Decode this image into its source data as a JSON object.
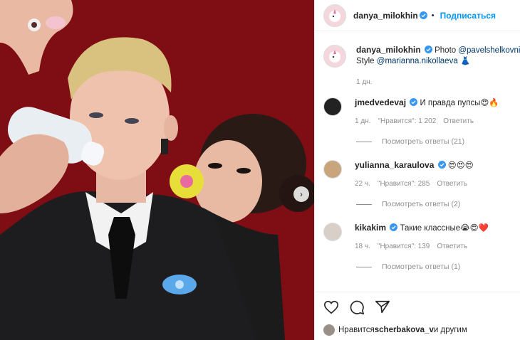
{
  "header": {
    "username": "danya_milokhin",
    "follow_label": "Подписаться",
    "dot": "•"
  },
  "caption": {
    "username": "danya_milokhin",
    "text_prefix": "Photo ",
    "mention_photo": "@pavelshelkovnikov",
    "text_style": "Style ",
    "mention_style": "@marianna.nikollaeva",
    "emoji": "👗",
    "time": "1 дн."
  },
  "comments": [
    {
      "username": "jmedvedevaj",
      "verified": true,
      "text": "И правда пупсы😍🔥",
      "time": "1 дн.",
      "likes": "\"Нравится\": 1 202",
      "reply_label": "Ответить",
      "replies_label": "Посмотреть ответы (21)"
    },
    {
      "username": "yulianna_karaulova",
      "verified": true,
      "text": "😍😍😍",
      "time": "22 ч.",
      "likes": "\"Нравится\": 285",
      "reply_label": "Ответить",
      "replies_label": "Посмотреть ответы (2)"
    },
    {
      "username": "kikakim",
      "verified": true,
      "text": "Такие классные😭😍❤️",
      "time": "18 ч.",
      "likes": "\"Нравится\": 139",
      "reply_label": "Ответить",
      "replies_label": "Посмотреть ответы (1)"
    }
  ],
  "actions": {
    "like_icon": "heart-icon",
    "comment_icon": "comment-icon",
    "share_icon": "share-icon"
  },
  "likes_line": {
    "prefix": "Нравится ",
    "user": "scherbakova_v",
    "suffix": " и другим"
  },
  "colors": {
    "accent": "#0095f6",
    "background_red": "#7c0c12",
    "verified": "#3897f0"
  }
}
